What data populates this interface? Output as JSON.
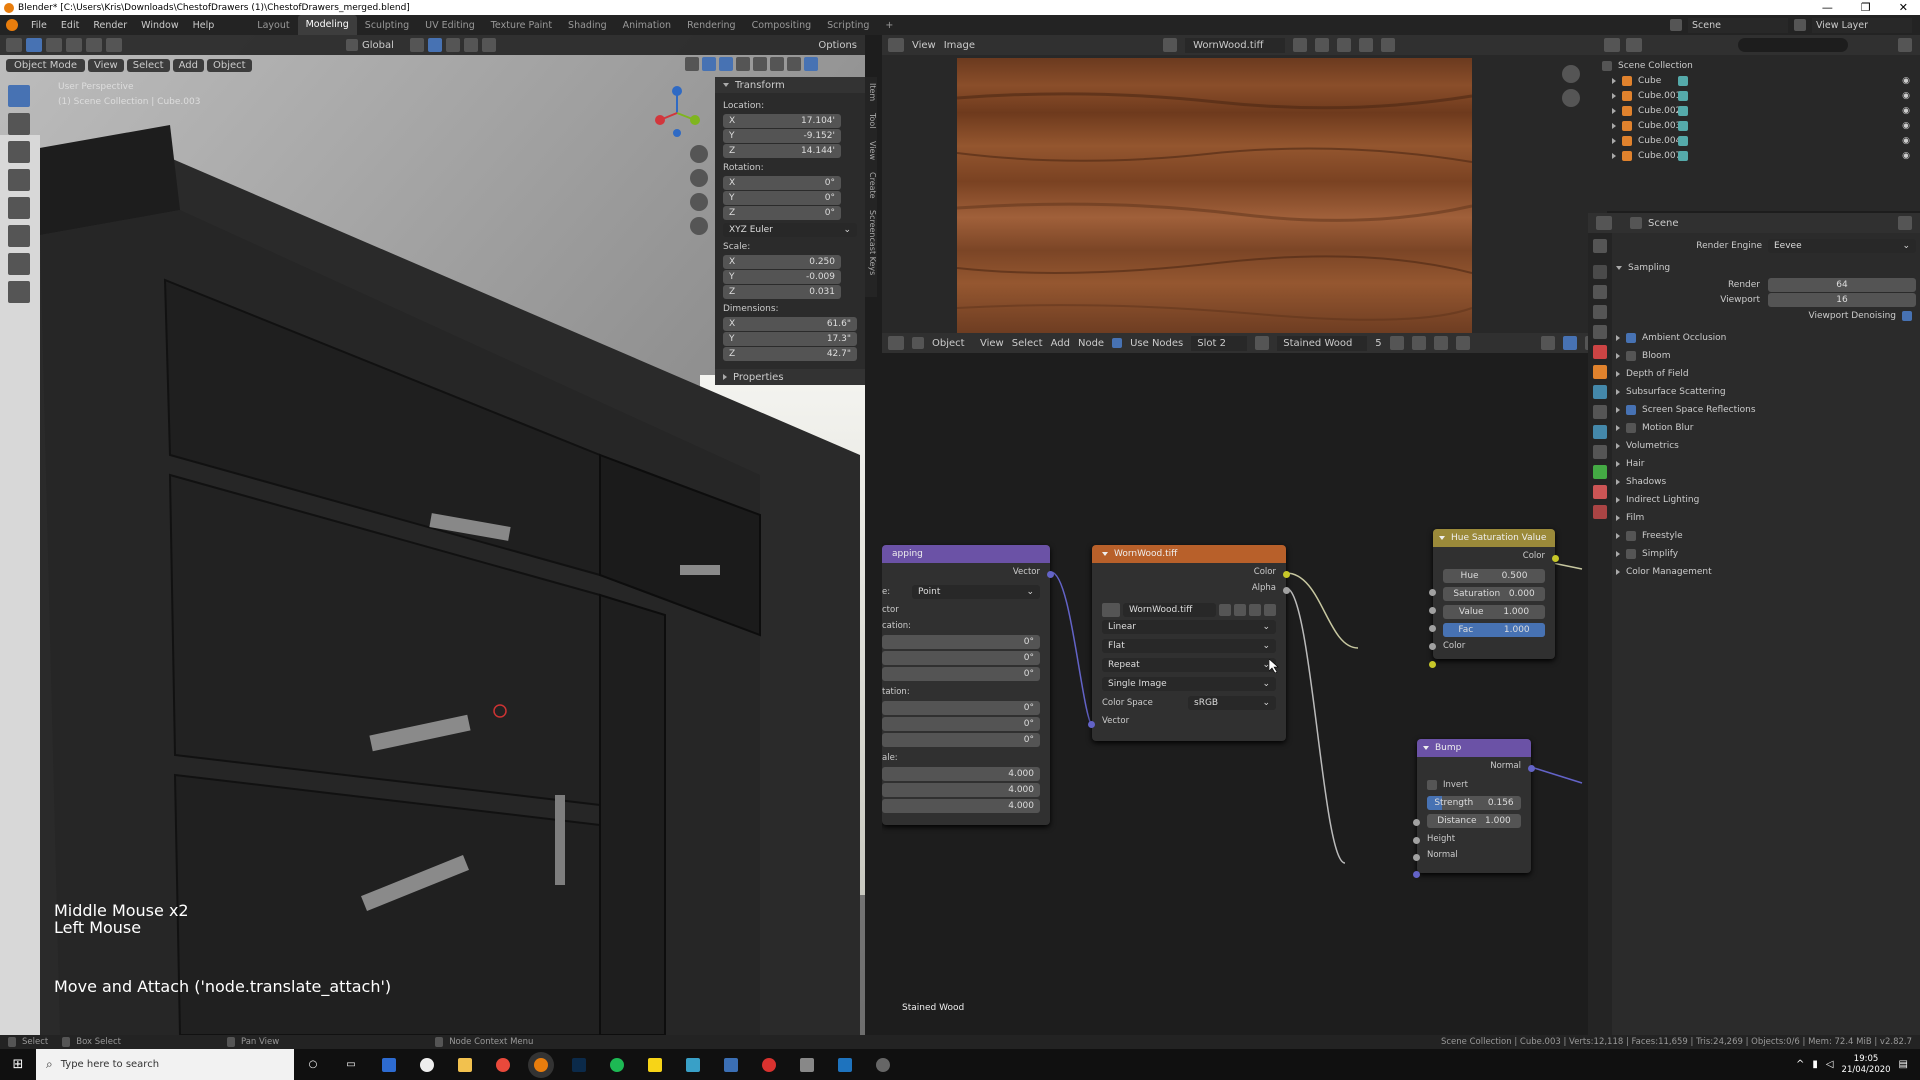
{
  "titlebar": {
    "title": "Blender* [C:\\Users\\Kris\\Downloads\\ChestofDrawers (1)\\ChestofDrawers_merged.blend]"
  },
  "menubar": {
    "menus": [
      "File",
      "Edit",
      "Render",
      "Window",
      "Help"
    ],
    "workspaces": [
      "Layout",
      "Modeling",
      "Sculpting",
      "UV Editing",
      "Texture Paint",
      "Shading",
      "Animation",
      "Rendering",
      "Compositing",
      "Scripting"
    ],
    "active_workspace": "Modeling",
    "scene": "Scene",
    "view_layer": "View Layer"
  },
  "viewport": {
    "mode": "Object Mode",
    "menus": [
      "View",
      "Select",
      "Add",
      "Object"
    ],
    "orientation": "Global",
    "options": "Options",
    "overlay_title": "User Perspective",
    "overlay_sub": "(1) Scene Collection | Cube.003",
    "key_hint_1": "Middle Mouse x2",
    "key_hint_2": "Left Mouse",
    "operator": "Move and Attach ('node.translate_attach')"
  },
  "npanel": {
    "section": "Transform",
    "location_label": "Location:",
    "location": [
      "17.104'",
      "-9.152'",
      "14.144'"
    ],
    "rotation_label": "Rotation:",
    "rotation": [
      "0°",
      "0°",
      "0°"
    ],
    "rotation_mode": "XYZ Euler",
    "scale_label": "Scale:",
    "scale": [
      "0.250",
      "-0.009",
      "0.031"
    ],
    "dimensions_label": "Dimensions:",
    "dimensions": [
      "61.6\"",
      "17.3\"",
      "42.7\""
    ],
    "properties": "Properties",
    "axes": [
      "X",
      "Y",
      "Z"
    ],
    "tabs": [
      "Item",
      "Tool",
      "View",
      "Create",
      "Screencast Keys"
    ]
  },
  "image_editor": {
    "menus": [
      "View",
      "Image"
    ],
    "image_name": "WornWood.tiff"
  },
  "node_editor": {
    "type": "Object",
    "menus": [
      "View",
      "Select",
      "Add",
      "Node"
    ],
    "use_nodes": "Use Nodes",
    "slot": "Slot 2",
    "material": "Stained Wood",
    "users": "5",
    "footer_label": "Stained Wood"
  },
  "mapping_node": {
    "title": "apping",
    "out_vector": "Vector",
    "type_label": "e:",
    "type_value": "Point",
    "vector_label": "ctor",
    "location_label": "cation:",
    "location": [
      "0°",
      "0°",
      "0°"
    ],
    "rotation_label": "tation:",
    "rotation": [
      "0°",
      "0°",
      "0°"
    ],
    "scale_label": "ale:",
    "scale": [
      "4.000",
      "4.000",
      "4.000"
    ]
  },
  "image_node": {
    "title": "WornWood.tiff",
    "out_color": "Color",
    "out_alpha": "Alpha",
    "image": "WornWood.tiff",
    "interp": "Linear",
    "proj": "Flat",
    "ext": "Repeat",
    "source": "Single Image",
    "cs_label": "Color Space",
    "cs_value": "sRGB",
    "in_vector": "Vector"
  },
  "hsv_node": {
    "title": "Hue Saturation Value",
    "out_color": "Color",
    "hue_label": "Hue",
    "hue": "0.500",
    "sat_label": "Saturation",
    "sat": "0.000",
    "val_label": "Value",
    "val": "1.000",
    "fac_label": "Fac",
    "fac": "1.000",
    "in_color": "Color",
    "fac_fraction": 1.0
  },
  "bump_node": {
    "title": "Bump",
    "out_normal": "Normal",
    "invert": "Invert",
    "strength_label": "Strength",
    "strength": "0.156",
    "distance_label": "Distance",
    "distance": "1.000",
    "in_height": "Height",
    "in_normal": "Normal",
    "strength_fraction": 0.156
  },
  "outliner": {
    "root": "Scene Collection",
    "items": [
      "Cube",
      "Cube.001",
      "Cube.002",
      "Cube.003",
      "Cube.004",
      "Cube.007"
    ],
    "search": ""
  },
  "properties": {
    "scene": "Scene",
    "engine_label": "Render Engine",
    "engine": "Eevee",
    "sampling": "Sampling",
    "render_label": "Render",
    "render": "64",
    "viewport_label": "Viewport",
    "viewport": "16",
    "denoise": "Viewport Denoising",
    "panels": [
      {
        "label": "Ambient Occlusion",
        "check": true
      },
      {
        "label": "Bloom",
        "check": false
      },
      {
        "label": "Depth of Field"
      },
      {
        "label": "Subsurface Scattering"
      },
      {
        "label": "Screen Space Reflections",
        "check": true
      },
      {
        "label": "Motion Blur",
        "check": false
      },
      {
        "label": "Volumetrics"
      },
      {
        "label": "Hair"
      },
      {
        "label": "Shadows"
      },
      {
        "label": "Indirect Lighting"
      },
      {
        "label": "Film"
      },
      {
        "label": "Freestyle",
        "check": false
      },
      {
        "label": "Simplify",
        "check": false
      },
      {
        "label": "Color Management"
      }
    ]
  },
  "statusbar": {
    "select": "Select",
    "box_select": "Box Select",
    "pan_view": "Pan View",
    "node_context": "Node Context Menu",
    "stats": "Scene Collection | Cube.003 | Verts:12,118 | Faces:11,659 | Tris:24,269 | Objects:0/6 | Mem: 72.4 MiB | v2.82.7"
  },
  "taskbar": {
    "search_placeholder": "Type here to search",
    "time": "19:05",
    "date": "21/04/2020"
  }
}
